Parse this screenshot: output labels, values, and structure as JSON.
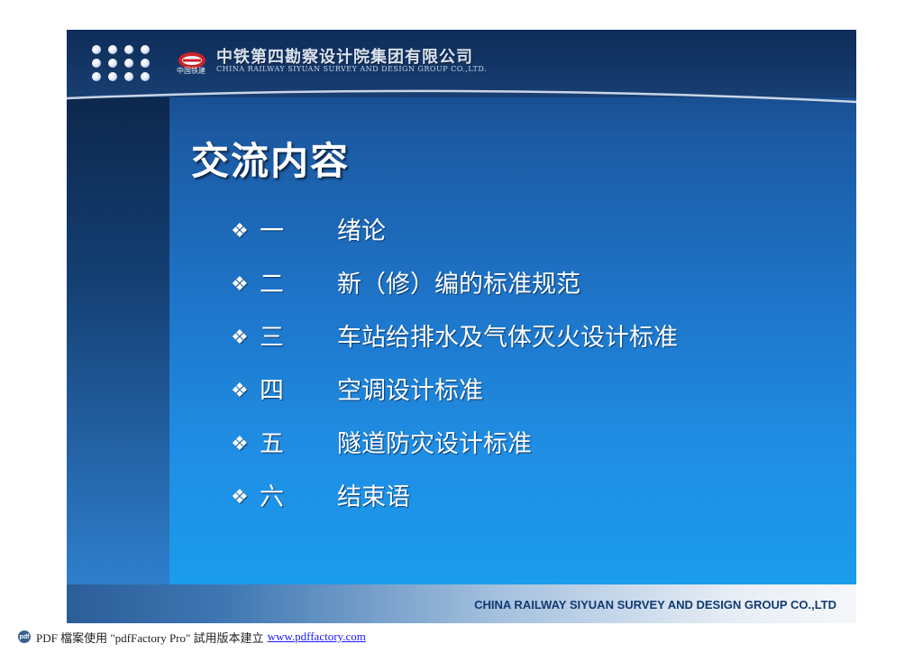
{
  "colors": {
    "slide_top": "#123b74",
    "slide_bottom": "#1aa0f0",
    "left_band": "#0a1f3e",
    "footer_text": "#123a70",
    "logo_red": "#c9232a"
  },
  "header": {
    "logo_icon": "crcc-logo",
    "logo_caption": "中国铁建",
    "company_cn": "中铁第四勘察设计院集团有限公司",
    "company_en": "CHINA RAILWAY SIYUAN SURVEY AND DESIGN GROUP CO.,LTD."
  },
  "title": "交流内容",
  "agenda": [
    {
      "bullet": "❖",
      "num": "一",
      "text": "绪论"
    },
    {
      "bullet": "❖",
      "num": "二",
      "text": "新（修）编的标准规范"
    },
    {
      "bullet": "❖",
      "num": "三",
      "text": "车站给排水及气体灭火设计标准"
    },
    {
      "bullet": "❖",
      "num": "四",
      "text": "空调设计标准"
    },
    {
      "bullet": "❖",
      "num": "五",
      "text": "隧道防灾设计标准"
    },
    {
      "bullet": "❖",
      "num": "六",
      "text": "结束语"
    }
  ],
  "footer": {
    "company": "CHINA RAILWAY SIYUAN SURVEY AND DESIGN GROUP CO.,LTD"
  },
  "pdf_note": {
    "icon": "pdf-icon",
    "icon_text": "pdf",
    "text": "PDF 檔案使用 \"pdfFactory Pro\" 試用版本建立",
    "link": "www.pdffactory.com"
  }
}
